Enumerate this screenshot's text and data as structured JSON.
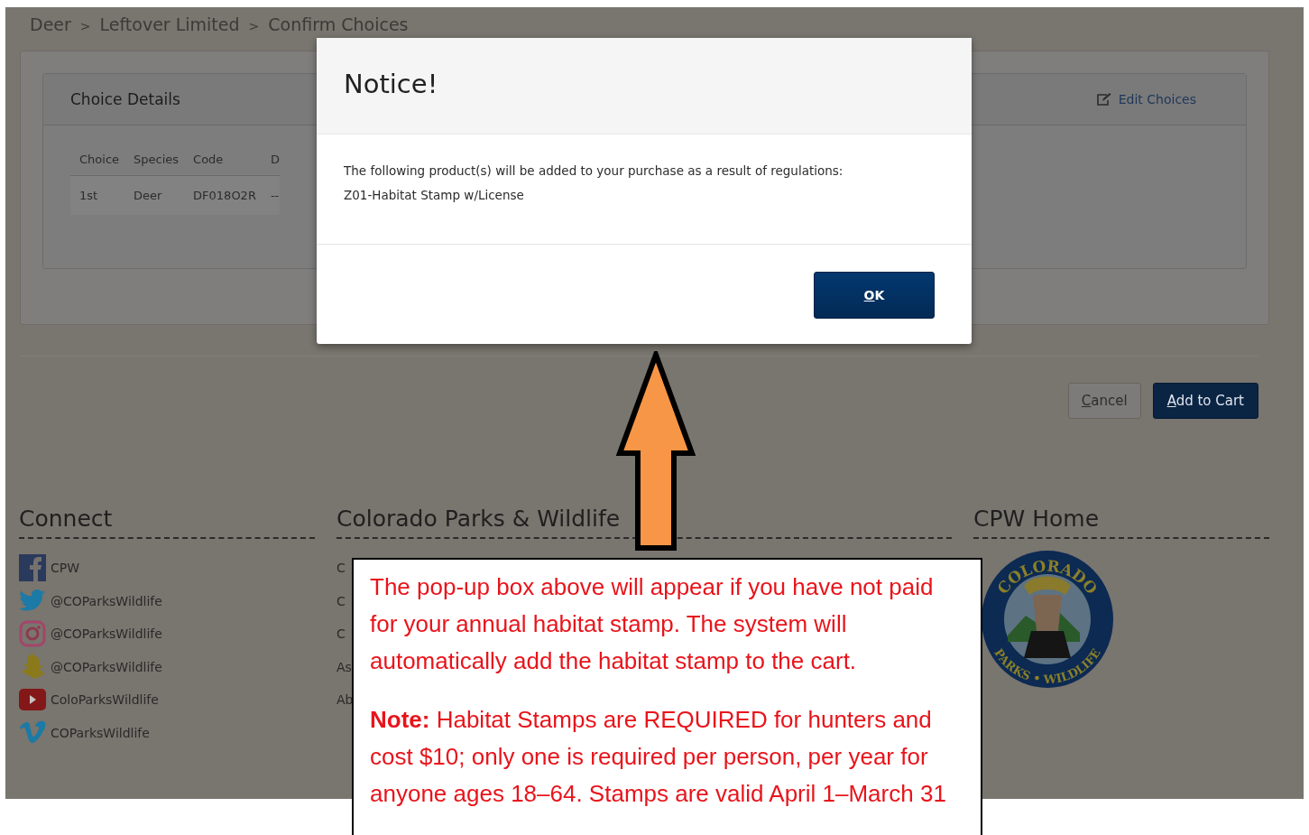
{
  "breadcrumb": [
    {
      "kind": "link",
      "text": "Deer"
    },
    {
      "kind": "separator",
      "text": ">"
    },
    {
      "kind": "link",
      "text": "Leftover Limited"
    },
    {
      "kind": "separator",
      "text": ">"
    },
    {
      "kind": "current",
      "text": "Confirm Choices"
    }
  ],
  "choice_details": {
    "title": "Choice Details",
    "edit_link": "Edit Choices",
    "table": {
      "columns": [
        "Choice",
        "Species",
        "Code",
        "D"
      ],
      "rows": [
        [
          "1st",
          "Deer",
          "DF018O2R",
          "--"
        ]
      ]
    }
  },
  "actions": [
    {
      "kind": "secondary",
      "label": "Cancel"
    },
    {
      "kind": "primary",
      "label": "Add to Cart"
    }
  ],
  "footer": [
    {
      "kind": "social",
      "title": "Connect",
      "items": [
        {
          "kind": "facebook",
          "text": "CPW"
        },
        {
          "kind": "twitter",
          "text": "@COParksWildlife"
        },
        {
          "kind": "instagram",
          "text": "@COParksWildlife"
        },
        {
          "kind": "snapchat",
          "text": "@COParksWildlife"
        },
        {
          "kind": "youtube",
          "text": "ColoParksWildlife"
        },
        {
          "kind": "vimeo",
          "text": "COParksWildlife"
        }
      ]
    },
    {
      "kind": "links",
      "title": "Colorado Parks & Wildlife",
      "items": [
        "C",
        "C",
        "C",
        "As",
        "Ab"
      ]
    },
    {
      "kind": "logo",
      "title": "CPW Home",
      "logo": {
        "top_text": "COLORADO",
        "bottom_text": "PARKS • WILDLIFE"
      }
    }
  ],
  "modal": {
    "title": "Notice!",
    "message": [
      "The following product(s) will be added to your purchase as a result of regulations:",
      "Z01-Habitat Stamp w/License"
    ],
    "button": "OK"
  },
  "annotation": {
    "paragraphs": [
      "The pop-up box above will appear if you have not paid for your annual habitat stamp. The system will automatically add the habitat stamp to the cart.",
      "**Note:** Habitat Stamps are REQUIRED for hunters and cost $10; only one is required per person, per year for anyone ages 18–64. Stamps are valid April 1–March 31"
    ]
  }
}
